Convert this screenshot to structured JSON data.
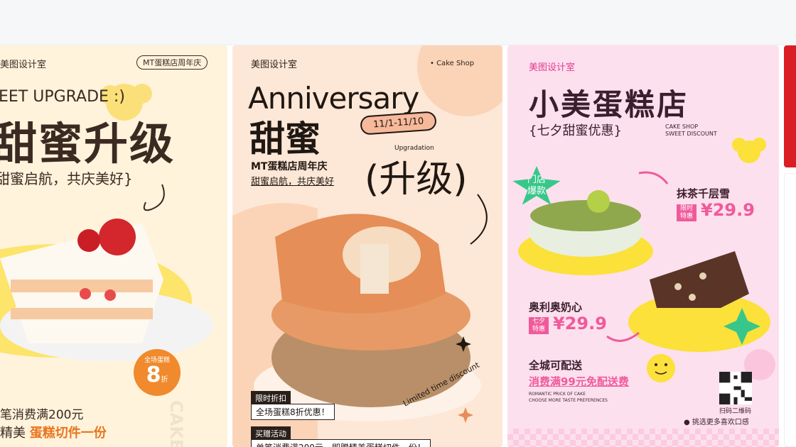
{
  "card1": {
    "logo": "美图设计室",
    "tag": "MT蛋糕店周年庆",
    "upgrade": "EET UPGRADE :)",
    "title": "甜蜜升级",
    "subtitle": "甜蜜启航，共庆美好}",
    "badge_small": "全场蛋糕",
    "badge_num": "8",
    "badge_unit": "折",
    "footer1": "笔消费满200元",
    "footer2_prefix": "精美",
    "footer2_hl": "蛋糕切件一份",
    "vertical": "CAKE"
  },
  "card2": {
    "logo": "美图设计室",
    "shop": "• Cake Shop",
    "anniversary": "Anniversary",
    "tianmi": "甜蜜",
    "date": "11/1-11/10",
    "upgradation": "Upgradation",
    "shengji": "(升级)",
    "store": "MT蛋糕店周年庆",
    "slogan": "甜蜜启航，共庆美好",
    "limit_head": "限时折扣",
    "limit_text": "全场蛋糕8折优惠！",
    "gift_head": "买赠活动",
    "gift_text": "单笔消费满200元，即赠精美蛋糕切件一份！",
    "limited": "Limited time discount"
  },
  "card3": {
    "logo": "美图设计室",
    "title": "小美蛋糕店",
    "subtitle": "{七夕甜蜜优惠}",
    "shop1": "CAKE SHOP",
    "shop2": "SWEET DISCOUNT",
    "hot_badge": "门店\n爆款",
    "p1_name": "抹茶千层雪",
    "p1_tag": "限时特惠",
    "p1_price": "¥29.9",
    "p2_name": "奥利奥奶心",
    "p2_tag": "七夕特惠",
    "p2_price": "¥29.9",
    "delivery": "全城可配送",
    "free": "消费满99元免配送费",
    "romantic1": "ROMANTIC PRICK OF CAKE",
    "romantic2": "CHOOSE MORE TASTE PREFERENCES",
    "scan": "扫码二维码",
    "more": "● 挑选更多喜欢口感"
  },
  "colors": {
    "card1_bg": "#fff3dc",
    "card2_bg": "#fde7d6",
    "card3_bg": "#fde0ee",
    "accent_orange": "#f08a2c",
    "accent_pink": "#f05a9b",
    "accent_green": "#37c78a"
  }
}
